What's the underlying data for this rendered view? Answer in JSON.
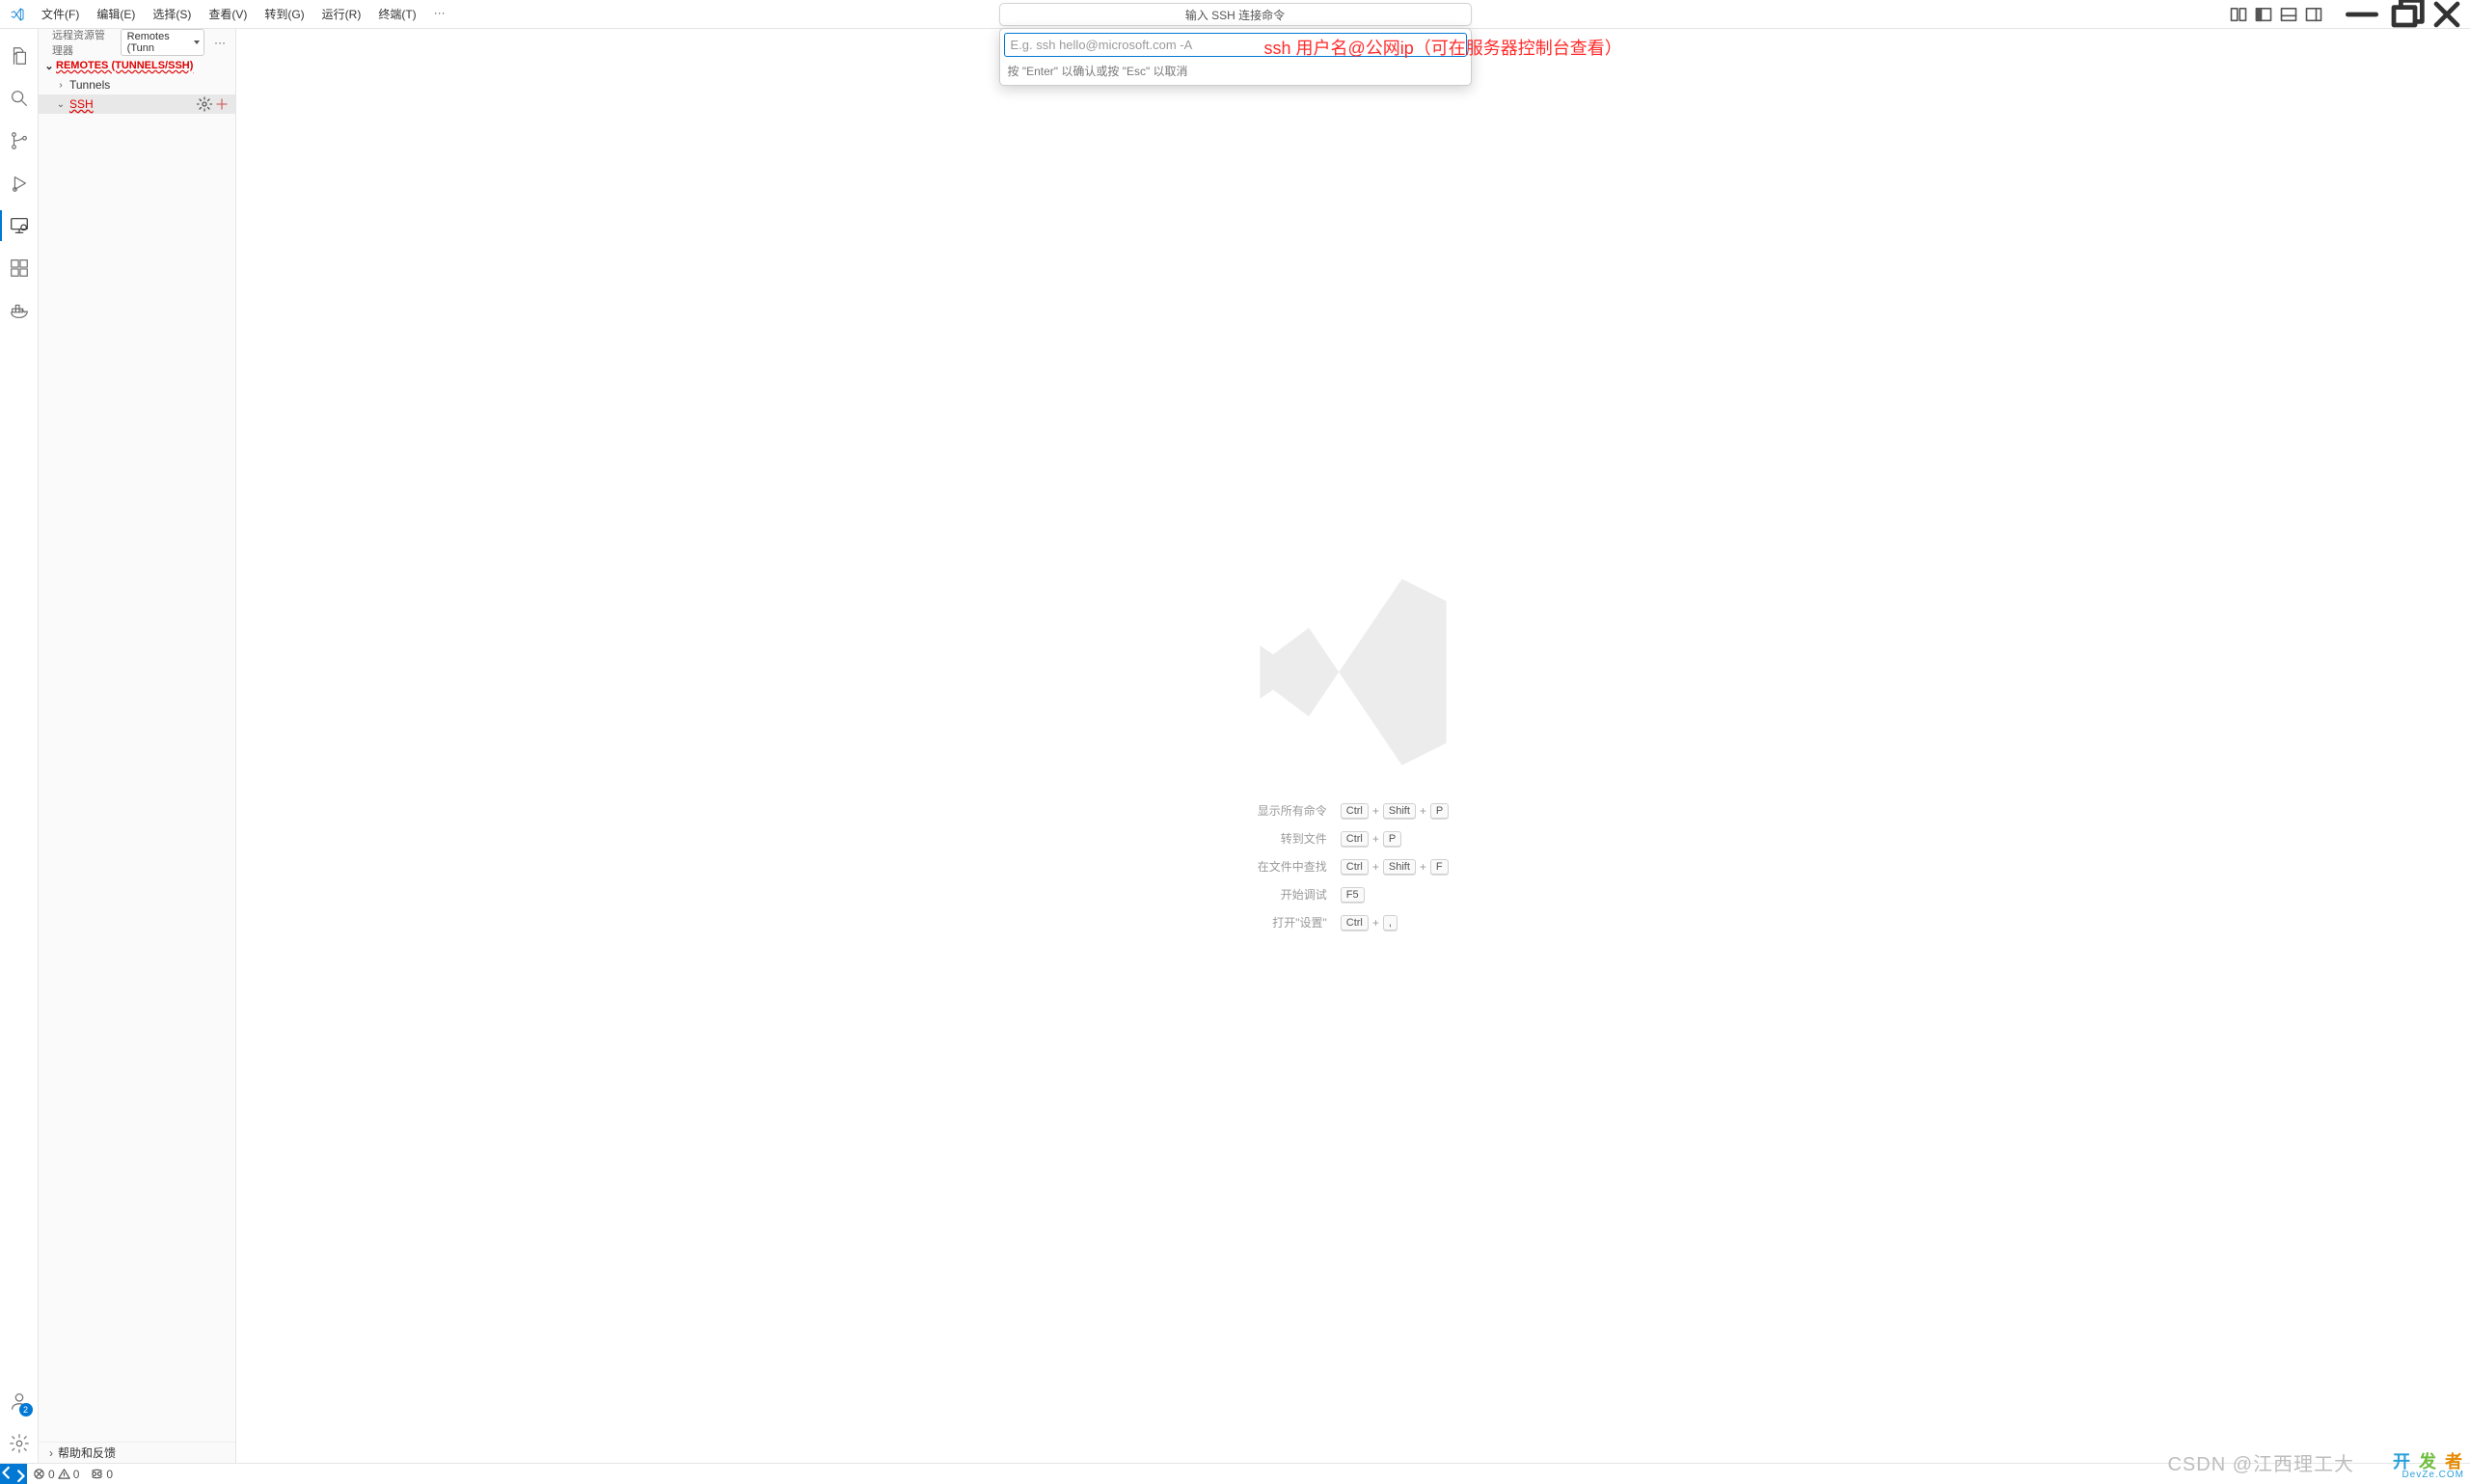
{
  "menubar": {
    "file": "文件(F)",
    "edit": "编辑(E)",
    "selection": "选择(S)",
    "view": "查看(V)",
    "go": "转到(G)",
    "run": "运行(R)",
    "terminal": "终端(T)"
  },
  "commandCenter": {
    "title": "输入 SSH 连接命令"
  },
  "quickInput": {
    "placeholder": "E.g. ssh hello@microsoft.com -A",
    "hint": "按 \"Enter\" 以确认或按 \"Esc\" 以取消"
  },
  "annotation": "ssh 用户名@公网ip（可在服务器控制台查看）",
  "sidebar": {
    "title": "远程资源管理器",
    "dropdown": "Remotes (Tunn",
    "section": "REMOTES (TUNNELS/SSH)",
    "items": [
      "Tunnels",
      "SSH"
    ],
    "footer": "帮助和反馈"
  },
  "accountsBadge": "2",
  "welcome": {
    "rows": [
      {
        "label": "显示所有命令",
        "keys": [
          "Ctrl",
          "+",
          "Shift",
          "+",
          "P"
        ]
      },
      {
        "label": "转到文件",
        "keys": [
          "Ctrl",
          "+",
          "P"
        ]
      },
      {
        "label": "在文件中查找",
        "keys": [
          "Ctrl",
          "+",
          "Shift",
          "+",
          "F"
        ]
      },
      {
        "label": "开始调试",
        "keys": [
          "F5"
        ]
      },
      {
        "label": "打开\"设置\"",
        "keys": [
          "Ctrl",
          "+",
          ","
        ]
      }
    ]
  },
  "status": {
    "errors": "0",
    "warnings": "0",
    "ports": "0"
  },
  "watermark": {
    "csdn": "CSDN @江西理工大",
    "brand_top": "开发者",
    "brand_bottom": "DevZe.COM"
  }
}
